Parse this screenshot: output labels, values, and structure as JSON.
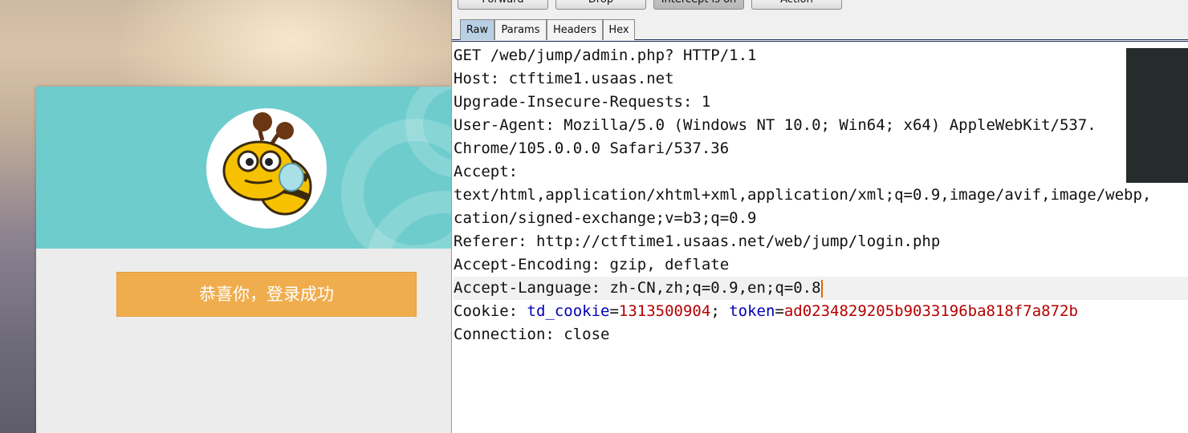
{
  "browser_page": {
    "success_message": "恭喜你，登录成功"
  },
  "burp": {
    "toolbar": {
      "buttons": [
        "Forward",
        "Drop",
        "Intercept is on",
        "Action"
      ]
    },
    "tabs": [
      "Raw",
      "Params",
      "Headers",
      "Hex"
    ],
    "active_tab": "Raw",
    "request_lines": [
      "GET /web/jump/admin.php? HTTP/1.1",
      "Host: ctftime1.usaas.net",
      "Upgrade-Insecure-Requests: 1",
      "User-Agent: Mozilla/5.0 (Windows NT 10.0; Win64; x64) AppleWebKit/537.",
      "Chrome/105.0.0.0 Safari/537.36",
      "Accept:",
      "text/html,application/xhtml+xml,application/xml;q=0.9,image/avif,image/webp,",
      "cation/signed-exchange;v=b3;q=0.9",
      "Referer: http://ctftime1.usaas.net/web/jump/login.php",
      "Accept-Encoding: gzip, deflate",
      "Accept-Language: zh-CN,zh;q=0.9,en;q=0.8"
    ],
    "cookie": {
      "prefix": "Cookie: ",
      "name1": "td_cookie",
      "value1": "1313500904",
      "sep": "; ",
      "name2": "token",
      "value2": "ad0234829205b9033196ba818f7a872b"
    },
    "connection_line": "Connection: close",
    "colors": {
      "cookie_name": "#0000b4",
      "cookie_value": "#b40000",
      "active_tab": "#b8cfe4",
      "banner": "#f0ad4e",
      "card_header": "#6ecccd"
    }
  }
}
